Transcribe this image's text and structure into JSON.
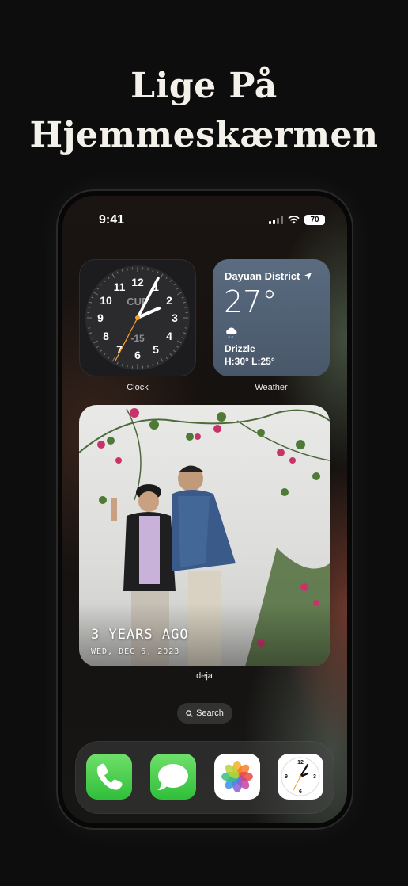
{
  "headline": {
    "line1": "Lige På",
    "line2": "Hjemmeskærmen"
  },
  "status_bar": {
    "time": "9:41",
    "battery": "70"
  },
  "widgets": {
    "clock": {
      "label": "Clock",
      "city": "CUP",
      "offset": "-15",
      "numbers": [
        "12",
        "1",
        "2",
        "3",
        "4",
        "5",
        "6",
        "7",
        "8",
        "9",
        "10",
        "11"
      ]
    },
    "weather": {
      "label": "Weather",
      "location": "Dayuan District",
      "temperature": "27°",
      "condition": "Drizzle",
      "high_low": "H:30° L:25°"
    },
    "photo": {
      "label": "deja",
      "headline": "3 YEARS AGO",
      "date": "WED, DEC 6, 2023"
    }
  },
  "search": {
    "label": "Search"
  },
  "dock": {
    "apps": [
      "phone",
      "messages",
      "photos",
      "clock"
    ],
    "clock_numbers": [
      "12",
      "3",
      "6",
      "9"
    ]
  },
  "colors": {
    "background": "#0d0d0d",
    "weather": "#5b6b80",
    "green": "#34c759",
    "hand": "#f4a030"
  }
}
